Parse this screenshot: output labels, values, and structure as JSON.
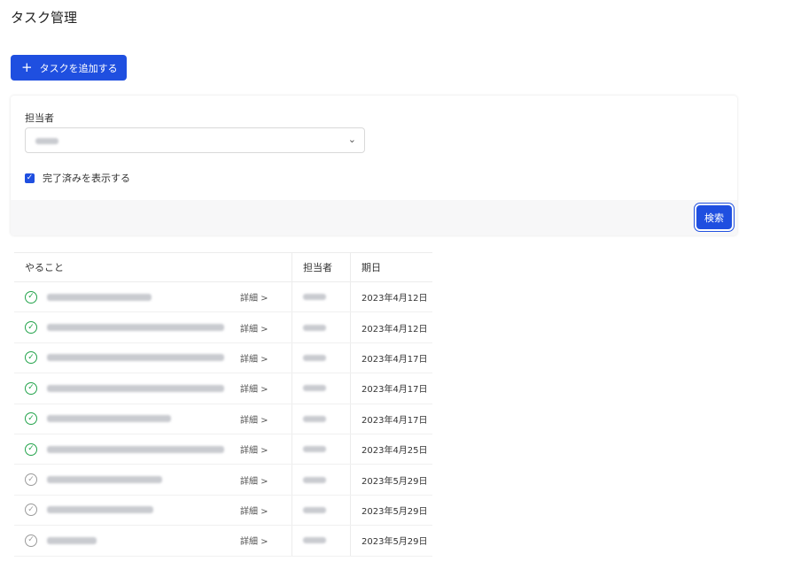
{
  "page": {
    "title": "タスク管理"
  },
  "toolbar": {
    "add_label": "タスクを追加する",
    "add_icon": "plus-icon"
  },
  "filter": {
    "assignee_label": "担当者",
    "assignee_value": "",
    "show_completed_label": "完了済みを表示する",
    "show_completed_checked": true,
    "search_label": "検索"
  },
  "table": {
    "headers": {
      "task": "やること",
      "assignee": "担当者",
      "due": "期日"
    },
    "detail_label": "詳細 >",
    "rows": [
      {
        "status": "done",
        "due": "2023年4月12日"
      },
      {
        "status": "done",
        "due": "2023年4月12日"
      },
      {
        "status": "done",
        "due": "2023年4月17日"
      },
      {
        "status": "done",
        "due": "2023年4月17日"
      },
      {
        "status": "done",
        "due": "2023年4月17日"
      },
      {
        "status": "done",
        "due": "2023年4月25日"
      },
      {
        "status": "todo",
        "due": "2023年5月29日"
      },
      {
        "status": "todo",
        "due": "2023年5月29日"
      },
      {
        "status": "todo",
        "due": "2023年5月29日"
      }
    ]
  },
  "colors": {
    "primary": "#1f4fe0",
    "done": "#22a34a",
    "todo": "#9a9a9a"
  }
}
